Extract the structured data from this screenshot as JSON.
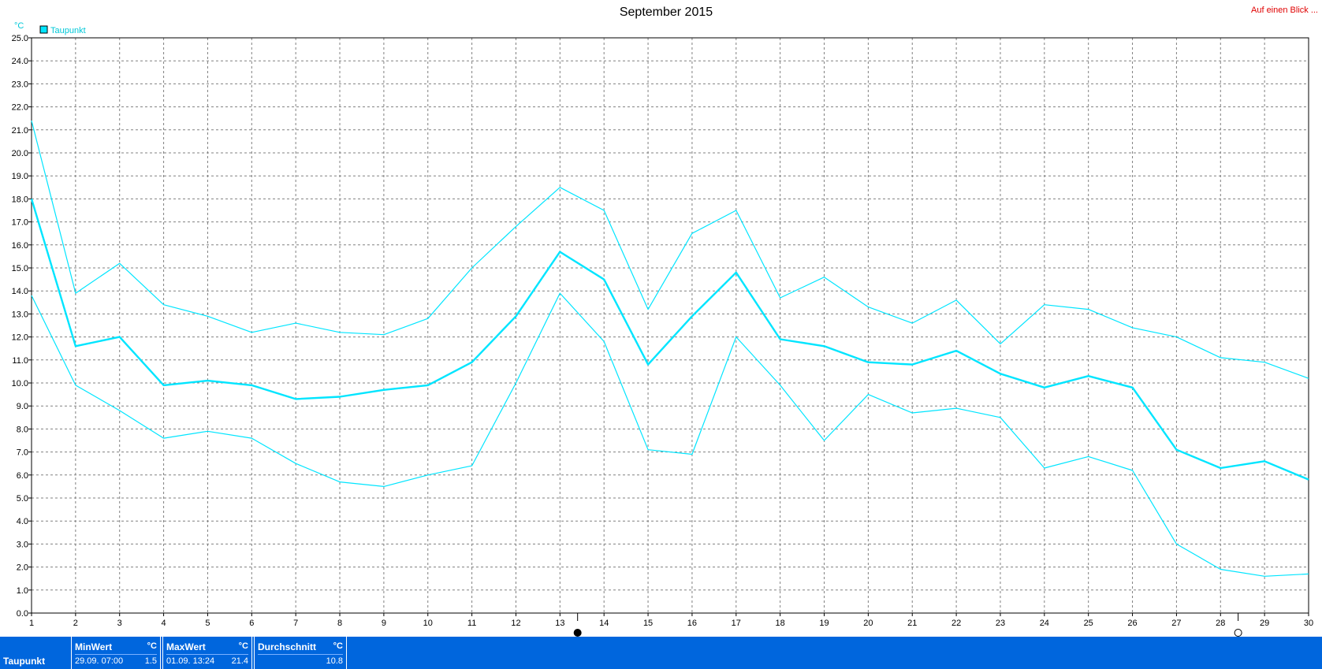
{
  "header": {
    "title": "September 2015",
    "corner_link": "Auf einen Blick ..."
  },
  "colors": {
    "series": "#00e5ff",
    "grid": "#808080",
    "stats_bar": "#0066dd",
    "link": "#e00000"
  },
  "chart_data": {
    "type": "line",
    "title": "September 2015",
    "ylabel": "°C",
    "xlabel": "",
    "ylim": [
      0,
      25
    ],
    "yticks": [
      "0.0",
      "1.0",
      "2.0",
      "3.0",
      "4.0",
      "5.0",
      "6.0",
      "7.0",
      "8.0",
      "9.0",
      "10.0",
      "11.0",
      "12.0",
      "13.0",
      "14.0",
      "15.0",
      "16.0",
      "17.0",
      "18.0",
      "19.0",
      "20.0",
      "21.0",
      "22.0",
      "23.0",
      "24.0",
      "25.0"
    ],
    "x": [
      1,
      2,
      3,
      4,
      5,
      6,
      7,
      8,
      9,
      10,
      11,
      12,
      13,
      14,
      15,
      16,
      17,
      18,
      19,
      20,
      21,
      22,
      23,
      24,
      25,
      26,
      27,
      28,
      29,
      30
    ],
    "grid": true,
    "legend": {
      "placement": "top-left",
      "entries": [
        "Taupunkt"
      ]
    },
    "series": [
      {
        "name": "Taupunkt",
        "role": "max",
        "values": [
          21.4,
          13.9,
          15.2,
          13.4,
          12.9,
          12.2,
          12.6,
          12.2,
          12.1,
          12.8,
          15.0,
          16.8,
          18.5,
          17.5,
          13.2,
          16.5,
          17.5,
          13.7,
          14.6,
          13.3,
          12.6,
          13.6,
          11.7,
          13.4,
          13.2,
          12.4,
          12.0,
          11.1,
          10.9,
          10.2
        ]
      },
      {
        "name": "Taupunkt",
        "role": "mean",
        "values": [
          18.0,
          11.6,
          12.0,
          9.9,
          10.1,
          9.9,
          9.3,
          9.4,
          9.7,
          9.9,
          10.9,
          12.9,
          15.7,
          14.5,
          10.8,
          12.9,
          14.8,
          11.9,
          11.6,
          10.9,
          10.8,
          11.4,
          10.4,
          9.8,
          10.3,
          9.8,
          7.1,
          6.3,
          6.6,
          5.8
        ]
      },
      {
        "name": "Taupunkt",
        "role": "min",
        "values": [
          13.8,
          9.9,
          8.8,
          7.6,
          7.9,
          7.6,
          6.5,
          5.7,
          5.5,
          6.0,
          6.4,
          10.0,
          13.9,
          11.8,
          7.1,
          6.9,
          12.0,
          9.9,
          7.5,
          9.5,
          8.7,
          8.9,
          8.5,
          6.3,
          6.8,
          6.2,
          3.0,
          1.9,
          1.6,
          1.7
        ]
      }
    ],
    "moon_markers": [
      {
        "after_day": 13,
        "phase": "full-moon-icon"
      },
      {
        "after_day": 28,
        "phase": "new-moon-icon"
      }
    ]
  },
  "stats": {
    "row_label": "Taupunkt",
    "min": {
      "label": "MinWert",
      "unit": "°C",
      "when": "29.09.  07:00",
      "value": "1.5"
    },
    "max": {
      "label": "MaxWert",
      "unit": "°C",
      "when": "01.09.  13:24",
      "value": "21.4"
    },
    "avg": {
      "label": "Durchschnitt",
      "unit": "°C",
      "when": "",
      "value": "10.8"
    }
  }
}
